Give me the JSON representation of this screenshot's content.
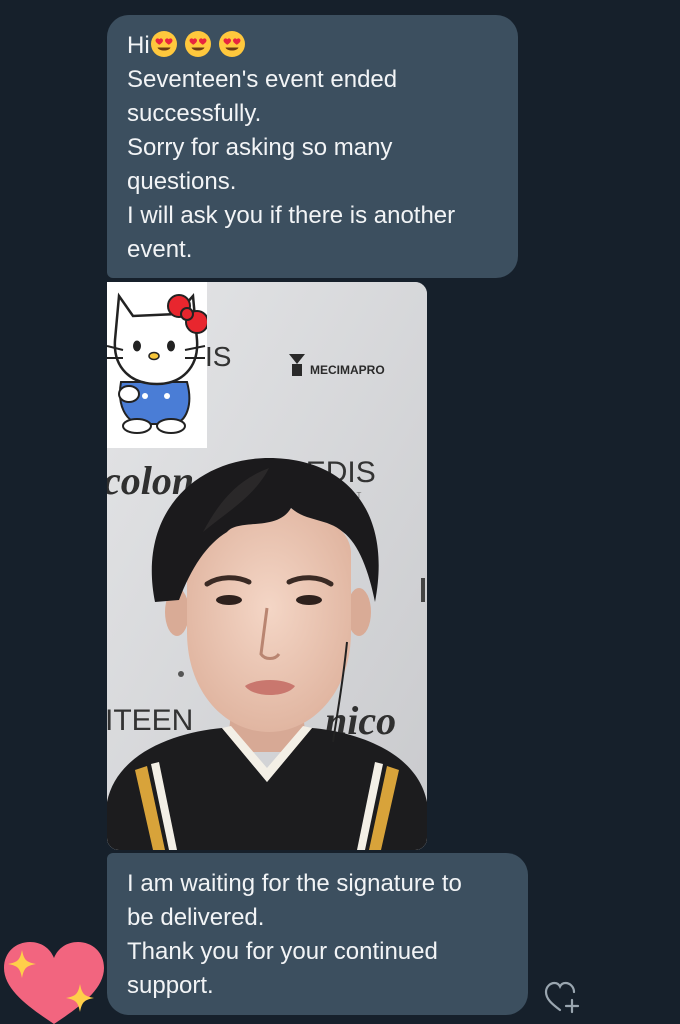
{
  "messages": [
    {
      "id": "m1",
      "lines": [
        "Hi",
        "Seventeen's event ended",
        "successfully.",
        "Sorry for asking so many",
        "questions.",
        "I will ask you if there is another",
        "event."
      ],
      "emojis": [
        "heart-eyes-emoji",
        "heart-eyes-emoji",
        "heart-eyes-emoji"
      ]
    },
    {
      "id": "m2",
      "type": "photo",
      "backdrop_text": {
        "brand_1": "MECIMAPRO",
        "brand_2": "PLEDIS",
        "brand_2_sub": "SIGNT",
        "left_fragment": "colon",
        "left_fragment_2": "IS",
        "bottom_left": "ITEEN",
        "bottom_right": "nico"
      },
      "sticker": "hello-kitty-sticker"
    },
    {
      "id": "m3",
      "lines": [
        "I am waiting for the signature to",
        "be delivered.",
        "Thank you for your continued",
        "support."
      ]
    }
  ],
  "colors": {
    "background": "#16202b",
    "bubble": "#3c4f5f",
    "text": "#f2f4f6",
    "reaction_heart": "#f2657f",
    "sparkle": "#ffcf4a"
  },
  "icons": {
    "reaction": "sparkle-heart-icon",
    "add_reaction": "add-reaction-heart-icon"
  }
}
